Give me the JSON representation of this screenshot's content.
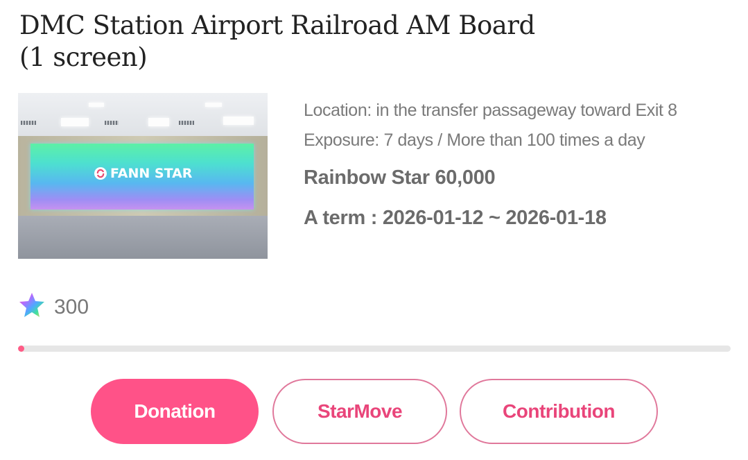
{
  "title": "DMC Station Airport Railroad AM Board (1 screen)",
  "image": {
    "logo_text": "FANN STAR"
  },
  "info": {
    "location": "Location: in the transfer passageway toward Exit 8",
    "exposure": "Exposure: 7 days / More than 100 times a day",
    "price": "Rainbow Star 60,000",
    "term": "A term : 2026-01-12 ~ 2026-01-18"
  },
  "stars": {
    "icon": "rainbow-star-icon",
    "count": "300"
  },
  "progress": {
    "percent": 0.9
  },
  "actions": {
    "donation": "Donation",
    "starmove": "StarMove",
    "contribution": "Contribution"
  },
  "colors": {
    "accent": "#ff5288",
    "accent_text": "#e9457a",
    "accent_border": "#e0789b",
    "track": "#e6e6e6"
  }
}
